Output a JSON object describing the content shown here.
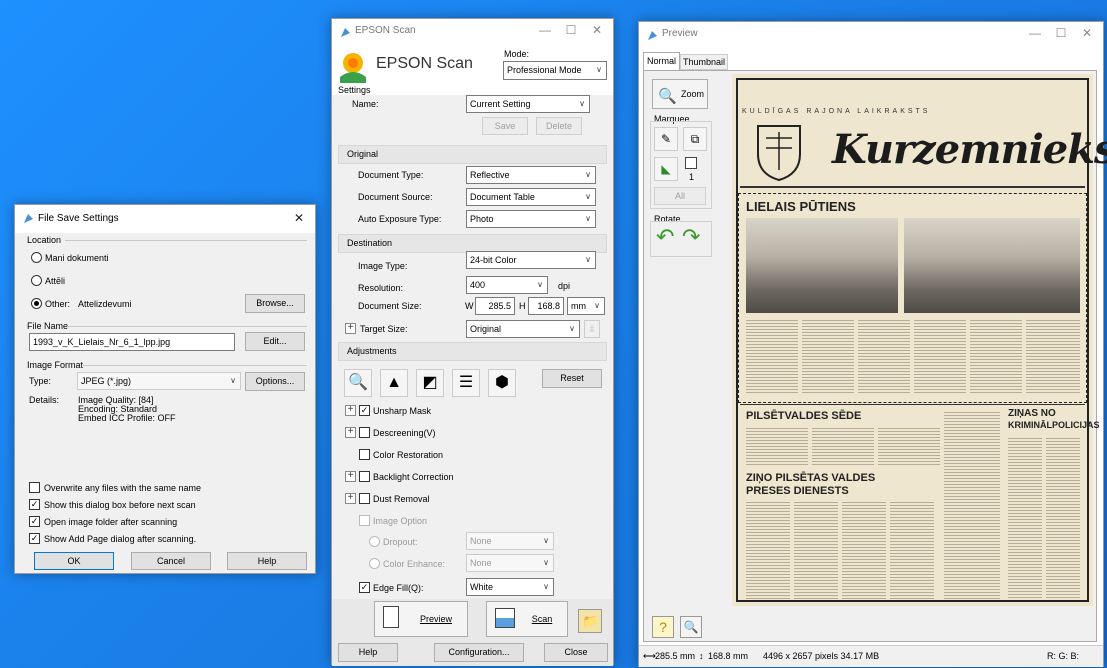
{
  "file_save": {
    "title": "File Save Settings",
    "location_label": "Location",
    "loc_options": [
      "Mani dokumenti",
      "Attēli",
      "Other:"
    ],
    "other_path": "Attelizdevumi",
    "browse": "Browse...",
    "file_name_label": "File Name",
    "file_name": "1993_v_K_Lielais_Nr_6_1_lpp.jpg",
    "edit": "Edit...",
    "image_format_label": "Image Format",
    "type_label": "Type:",
    "type_value": "JPEG (*.jpg)",
    "options": "Options...",
    "details_label": "Details:",
    "details": [
      "Image Quality: [84]",
      "Encoding: Standard",
      "Embed ICC Profile: OFF"
    ],
    "checks": [
      {
        "label": "Overwrite any files with the same name",
        "checked": false
      },
      {
        "label": "Show this dialog box before next scan",
        "checked": true
      },
      {
        "label": "Open image folder after scanning",
        "checked": true
      },
      {
        "label": "Show Add Page dialog after scanning.",
        "checked": true
      }
    ],
    "ok": "OK",
    "cancel": "Cancel",
    "help": "Help"
  },
  "epson": {
    "title": "EPSON Scan",
    "logo": "EPSON Scan",
    "mode_label": "Mode:",
    "mode_value": "Professional Mode",
    "settings_label": "Settings",
    "name_label": "Name:",
    "name_value": "Current Setting",
    "save": "Save",
    "delete": "Delete",
    "original_header": "Original",
    "doc_type_label": "Document Type:",
    "doc_type": "Reflective",
    "doc_source_label": "Document Source:",
    "doc_source": "Document Table",
    "auto_exp_label": "Auto Exposure Type:",
    "auto_exp": "Photo",
    "destination_header": "Destination",
    "image_type_label": "Image Type:",
    "image_type": "24-bit Color",
    "resolution_label": "Resolution:",
    "resolution": "400",
    "dpi": "dpi",
    "doc_size_label": "Document Size:",
    "w_label": "W",
    "w_value": "285.5",
    "h_label": "H",
    "h_value": "168.8",
    "unit": "mm",
    "target_size_label": "Target Size:",
    "target_size": "Original",
    "adjustments_header": "Adjustments",
    "reset": "Reset",
    "unsharp": "Unsharp Mask",
    "descreening": "Descreening(V)",
    "color_restoration": "Color Restoration",
    "backlight": "Backlight Correction",
    "dust": "Dust Removal",
    "image_option": "Image Option",
    "dropout_label": "Dropout:",
    "dropout": "None",
    "color_enhance_label": "Color Enhance:",
    "color_enhance": "None",
    "edge_fill_label": "Edge Fill(Q):",
    "edge_fill": "White",
    "preview": "Preview",
    "scan": "Scan",
    "help": "Help",
    "configuration": "Configuration...",
    "close": "Close"
  },
  "preview": {
    "title": "Preview",
    "tab_normal": "Normal",
    "tab_thumbnail": "Thumbnail",
    "zoom": "Zoom",
    "marquee_label": "Marquee",
    "marquee_count": "1",
    "all": "All",
    "rotate_label": "Rotate",
    "status_size": "285.5 mm",
    "status_size2": "168.8 mm",
    "status_pixels": "4496 x 2657 pixels 34.17 MB",
    "status_rgb": "R: G: B:"
  },
  "newspaper": {
    "header": "KULDĪGAS RAJONA LAIKRAKSTS",
    "masthead": "Kurzemnieks",
    "headline1": "LIELAIS PŪTIENS",
    "headline2": "PILSĒTVALDES SĒDE",
    "headline3a": "ZIŅO PILSĒTAS VALDES",
    "headline3b": "PRESES DIENESTS",
    "headline4a": "ZIŅAS NO",
    "headline4b": "KRIMINĀLPOLICIJAS"
  },
  "colors": {
    "desktop": "#1a7fe8",
    "rotate_arrow": "#3a9a2a",
    "paper": "#efe6cf"
  }
}
